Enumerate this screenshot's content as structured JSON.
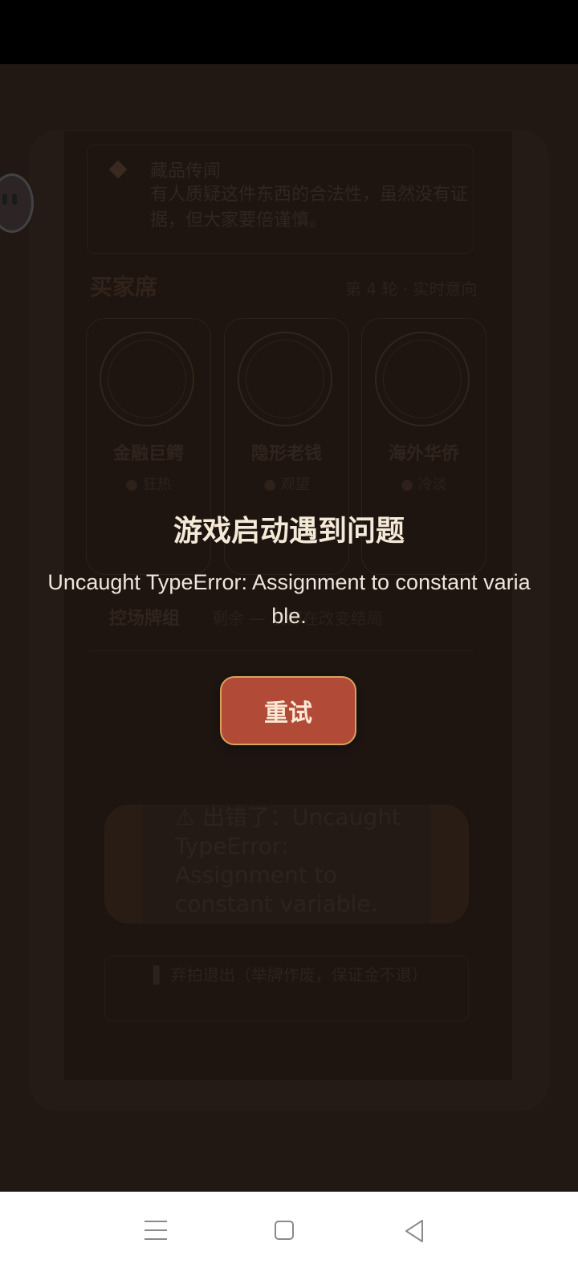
{
  "background_game": {
    "news": {
      "title": "藏品传闻",
      "body": "有人质疑这件东西的合法性，虽然没有证据，但大家要倍谨慎。"
    },
    "buyers_title": "买家席",
    "round_info": "第 4 轮 · 实时意向",
    "buyers": [
      {
        "name": "金融巨鳄",
        "mood": "● 狂热"
      },
      {
        "name": "隐形老钱",
        "mood": "● 观望"
      },
      {
        "name": "海外华侨",
        "mood": "● 冷淡"
      }
    ],
    "controls_label": "控场牌组",
    "controls_hint": "剩余 — 次都在改变结局",
    "error_box": {
      "text": "⚠ 出错了：Uncaught TypeError: Assignment to constant variable."
    },
    "quit_button": {
      "label": "▌ 弃拍退出（举牌作废，保证金不退）"
    }
  },
  "dialog": {
    "title": "游戏启动遇到问题",
    "message": "Uncaught TypeError: Assignment to constant variable.",
    "retry_label": "重试"
  },
  "colors": {
    "button_fill": "#b14a37",
    "button_border": "#d9a25c",
    "background": "#2b1f1a"
  },
  "icons": [
    "robot-assistant-icon",
    "menu-icon",
    "home-icon",
    "back-icon"
  ]
}
